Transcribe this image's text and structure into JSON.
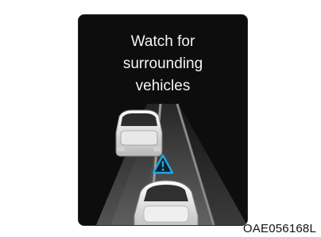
{
  "display": {
    "message_lines": [
      "Watch for",
      "surrounding",
      "vehicles"
    ]
  },
  "icons": {
    "warning": "warning-triangle-icon"
  },
  "colors": {
    "background": "#0d0d0d",
    "text": "#f4f4f4",
    "warning_icon": "#1fa7e0"
  },
  "figure": {
    "code": "OAE056168L"
  }
}
